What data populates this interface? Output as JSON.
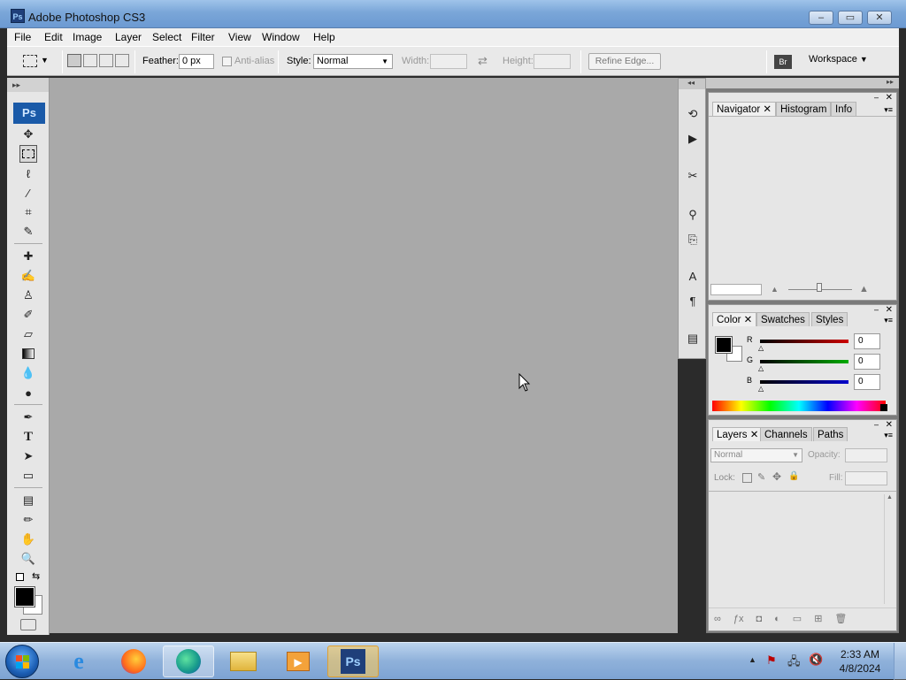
{
  "window": {
    "title": "Adobe Photoshop CS3",
    "app_icon": "Ps"
  },
  "menu": [
    "File",
    "Edit",
    "Image",
    "Layer",
    "Select",
    "Filter",
    "View",
    "Window",
    "Help"
  ],
  "options": {
    "feather_label": "Feather:",
    "feather_value": "0 px",
    "antialias_label": "Anti-alias",
    "style_label": "Style:",
    "style_value": "Normal",
    "width_label": "Width:",
    "height_label": "Height:",
    "refine_edge_label": "Refine Edge...",
    "workspace_label": "Workspace"
  },
  "toolbox": {
    "logo": "Ps"
  },
  "panels": {
    "navigator_tabs": [
      "Navigator",
      "Histogram",
      "Info"
    ],
    "color_tabs": [
      "Color",
      "Swatches",
      "Styles"
    ],
    "color_channels": [
      {
        "label": "R",
        "value": "0",
        "color": "#cc0000"
      },
      {
        "label": "G",
        "value": "0",
        "color": "#00aa00"
      },
      {
        "label": "B",
        "value": "0",
        "color": "#0000cc"
      }
    ],
    "layers_tabs": [
      "Layers",
      "Channels",
      "Paths"
    ],
    "blend_mode": "Normal",
    "opacity_label": "Opacity:",
    "lock_label": "Lock:",
    "fill_label": "Fill:"
  },
  "taskbar": {
    "time": "2:33 AM",
    "date": "4/8/2024"
  }
}
